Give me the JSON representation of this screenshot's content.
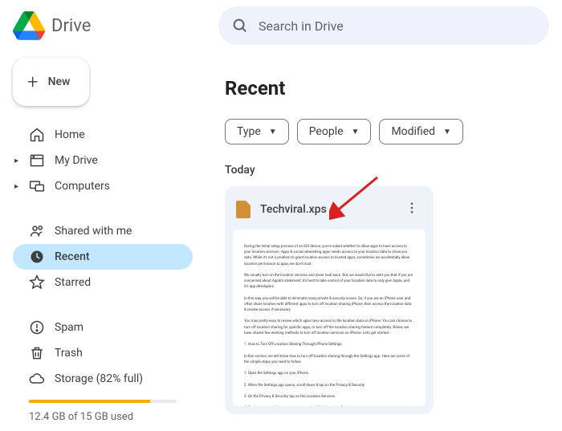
{
  "header": {
    "app_name": "Drive",
    "search_placeholder": "Search in Drive"
  },
  "sidebar": {
    "new_label": "New",
    "items": [
      {
        "label": "Home",
        "icon": "home-icon"
      },
      {
        "label": "My Drive",
        "icon": "drive-icon"
      },
      {
        "label": "Computers",
        "icon": "computers-icon"
      },
      {
        "label": "Shared with me",
        "icon": "shared-icon"
      },
      {
        "label": "Recent",
        "icon": "recent-icon"
      },
      {
        "label": "Starred",
        "icon": "star-icon"
      },
      {
        "label": "Spam",
        "icon": "spam-icon"
      },
      {
        "label": "Trash",
        "icon": "trash-icon"
      },
      {
        "label": "Storage (82% full)",
        "icon": "cloud-icon"
      }
    ],
    "storage_percent": 82,
    "storage_text": "12.4 GB of 15 GB used"
  },
  "main": {
    "title": "Recent",
    "filters": [
      {
        "label": "Type"
      },
      {
        "label": "People"
      },
      {
        "label": "Modified"
      }
    ],
    "section_label": "Today",
    "file": {
      "name": "Techviral.xps"
    }
  }
}
